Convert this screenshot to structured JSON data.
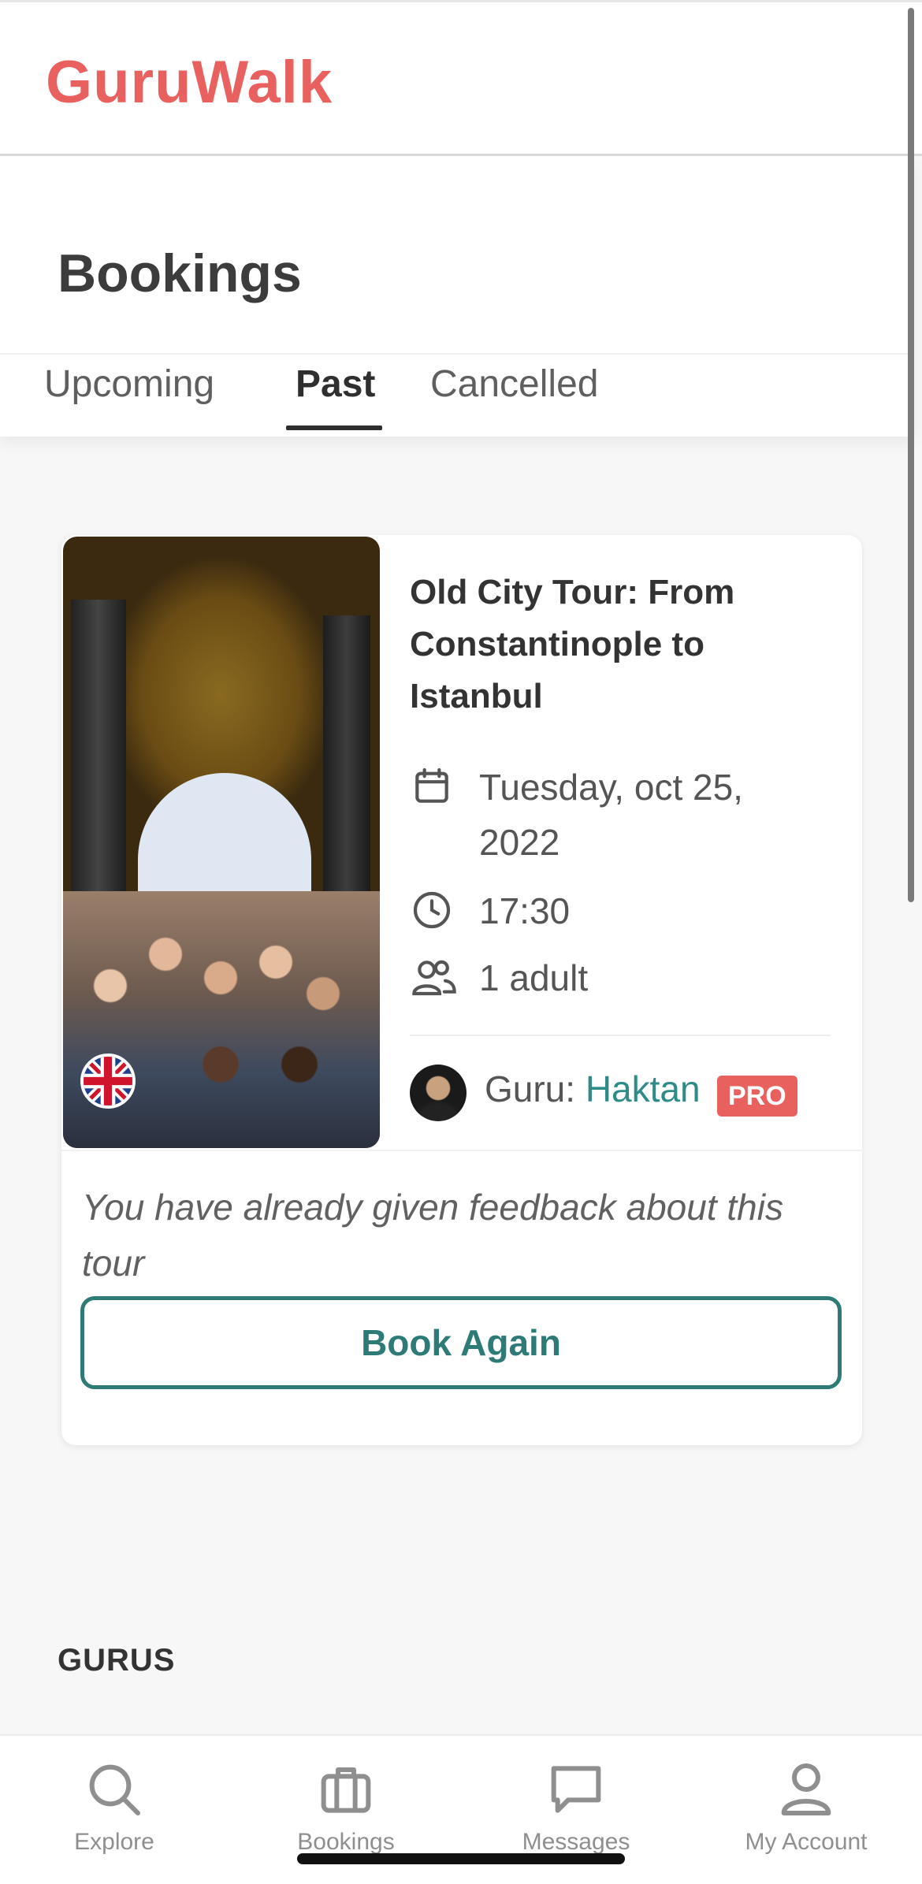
{
  "app": {
    "logo": "GuruWalk"
  },
  "page": {
    "title": "Bookings"
  },
  "tabs": [
    {
      "label": "Upcoming",
      "active": false
    },
    {
      "label": "Past",
      "active": true
    },
    {
      "label": "Cancelled",
      "active": false
    }
  ],
  "booking": {
    "title": "Old City Tour: From Constantinople to Istanbul",
    "date": "Tuesday, oct 25, 2022",
    "time": "17:30",
    "people": "1 adult",
    "language_flag": "uk-flag-icon",
    "guru_prefix": "Guru: ",
    "guru_name": "Haktan",
    "guru_badge": "PRO",
    "feedback_note": "You have already given feedback about this tour",
    "action_label": "Book Again"
  },
  "sections": {
    "gurus_heading": "GURUS"
  },
  "nav": {
    "items": [
      {
        "label": "Explore",
        "icon": "search-icon"
      },
      {
        "label": "Bookings",
        "icon": "briefcase-icon"
      },
      {
        "label": "Messages",
        "icon": "chat-bubble-icon"
      },
      {
        "label": "My Account",
        "icon": "user-icon"
      }
    ]
  },
  "colors": {
    "brand": "#e8615f",
    "accent": "#2d7a77",
    "guru_name": "#2e8b88"
  }
}
